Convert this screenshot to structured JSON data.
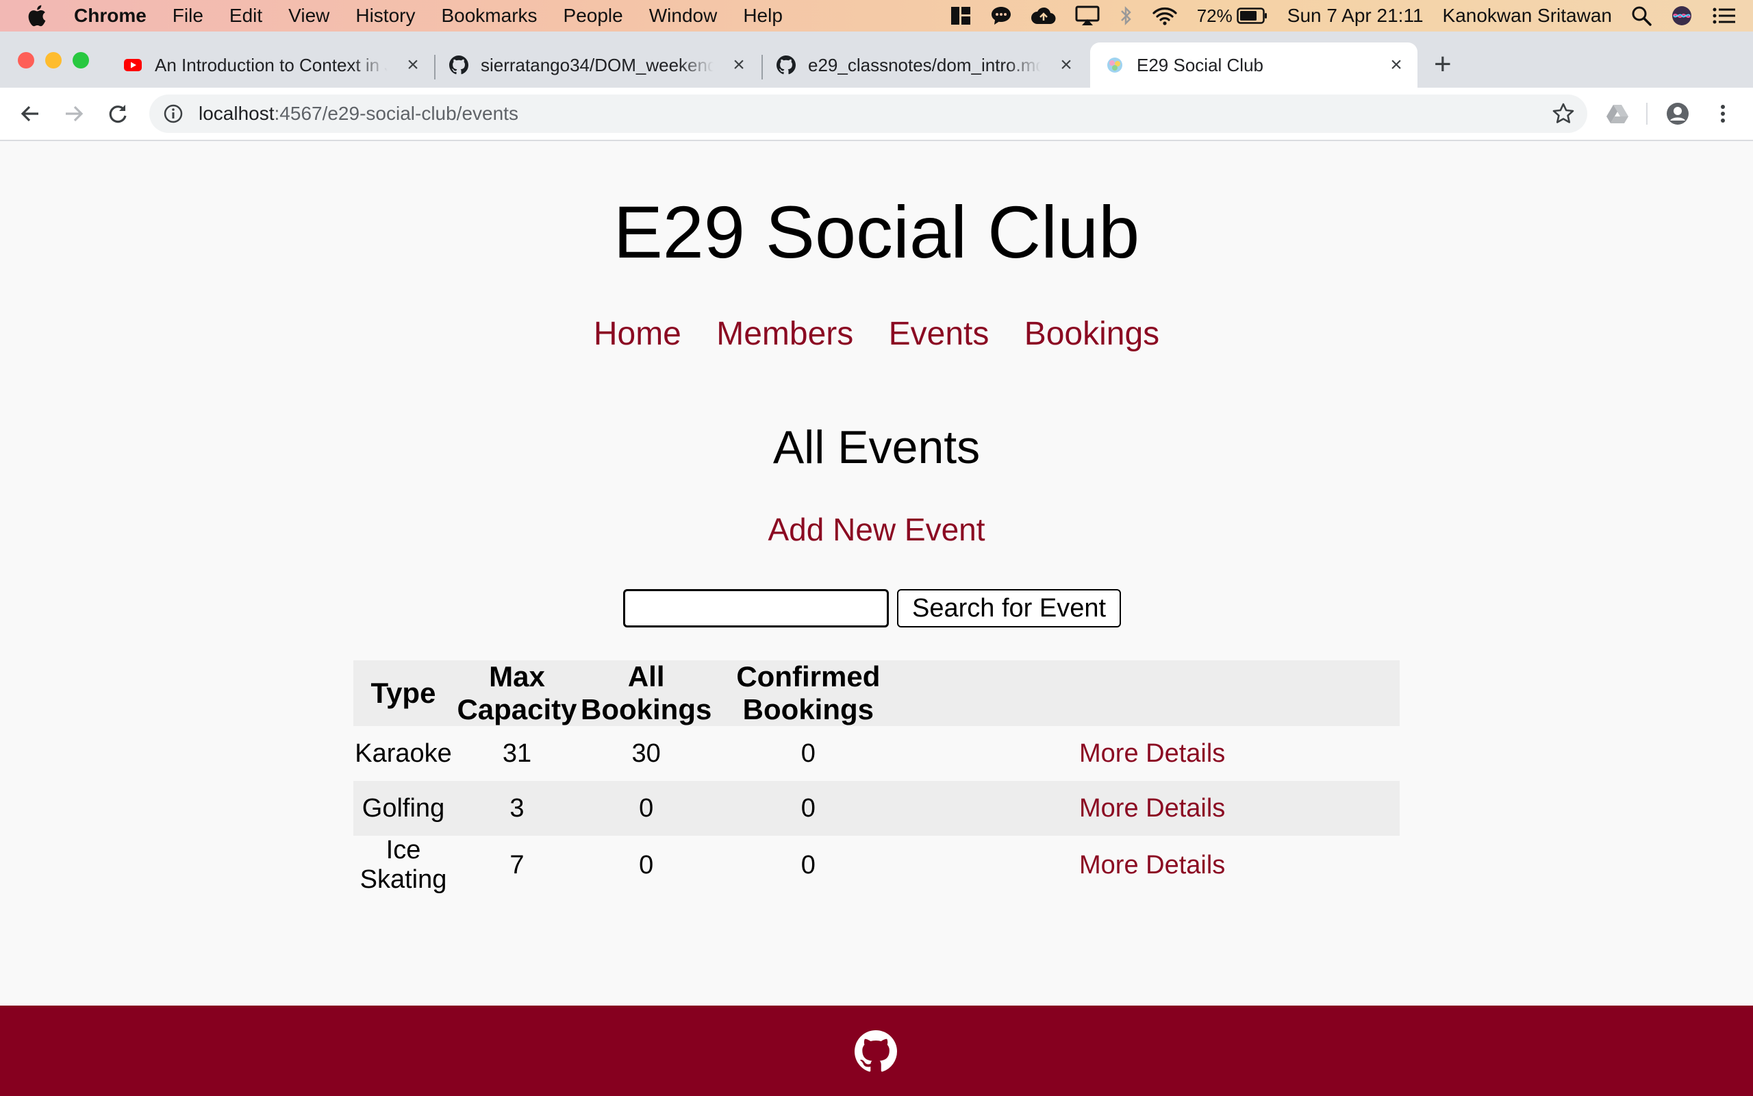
{
  "os_menubar": {
    "app_name": "Chrome",
    "menus": [
      "File",
      "Edit",
      "View",
      "History",
      "Bookmarks",
      "People",
      "Window",
      "Help"
    ],
    "battery_percent": "72%",
    "datetime": "Sun 7 Apr  21:11",
    "user_name": "Kanokwan Sritawan"
  },
  "browser": {
    "tabs": [
      {
        "title": "An Introduction to Context in JavaScript",
        "favicon": "youtube-icon"
      },
      {
        "title": "sierratango34/DOM_weekend_homework",
        "favicon": "github-icon"
      },
      {
        "title": "e29_classnotes/dom_intro.md at master",
        "favicon": "github-icon"
      },
      {
        "title": "E29 Social Club",
        "favicon": "site-favicon",
        "active": true
      }
    ],
    "url_host": "localhost",
    "url_path": ":4567/e29-social-club/events"
  },
  "page": {
    "site_title": "E29 Social Club",
    "nav": [
      "Home",
      "Members",
      "Events",
      "Bookings"
    ],
    "section_title": "All Events",
    "add_event_label": "Add New Event",
    "search_value": "",
    "search_button_label": "Search for Event",
    "table": {
      "headers": [
        "Type",
        "Max Capacity",
        "All Bookings",
        "Confirmed Bookings",
        ""
      ],
      "rows": [
        {
          "type": "Karaoke",
          "max_capacity": "31",
          "all_bookings": "30",
          "confirmed_bookings": "0",
          "link": "More Details"
        },
        {
          "type": "Golfing",
          "max_capacity": "3",
          "all_bookings": "0",
          "confirmed_bookings": "0",
          "link": "More Details"
        },
        {
          "type": "Ice Skating",
          "max_capacity": "7",
          "all_bookings": "0",
          "confirmed_bookings": "0",
          "link": "More Details"
        }
      ]
    },
    "footer_icon": "github-icon"
  },
  "colors": {
    "accent": "#8b0a22",
    "footer_bg": "#86001f",
    "table_stripe": "#ededed"
  }
}
